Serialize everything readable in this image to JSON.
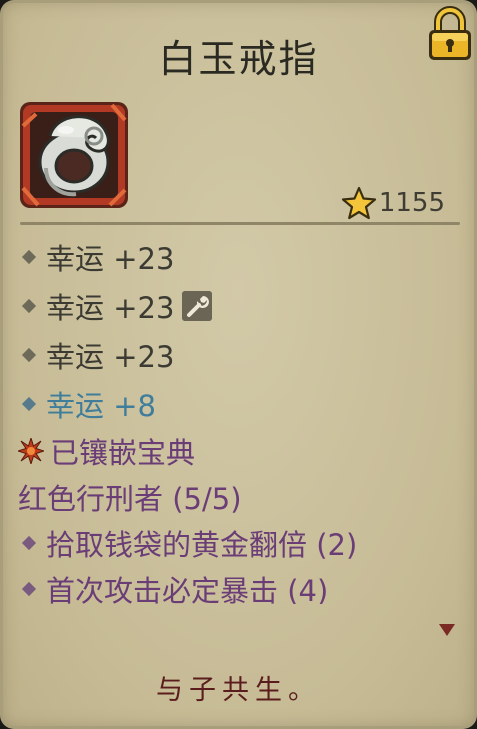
{
  "item": {
    "title": "白玉戒指",
    "icon": "jade-ring-icon",
    "score": "1155",
    "score_icon": "star-icon",
    "locked": true
  },
  "stats": [
    {
      "label": "幸运 +23",
      "color": "#3c3b33"
    },
    {
      "label": "幸运 +23",
      "color": "#3c3b33",
      "icon": "wrench-icon"
    },
    {
      "label": "幸运 +23",
      "color": "#3c3b33"
    },
    {
      "label": "幸运 +8",
      "color": "#3f7d9b"
    }
  ],
  "gem": {
    "label": "已镶嵌宝典",
    "icon": "red-burst-icon"
  },
  "set": {
    "name": "红色行刑者 (5/5)",
    "bonuses": [
      "拾取钱袋的黄金翻倍 (2)",
      "首次攻击必定暴击 (4)"
    ]
  },
  "flavor_text": "与子共生。",
  "colors": {
    "panel": "#c9bf9c",
    "normal_text": "#3c3b33",
    "magic_text": "#3f7d9b",
    "set_text": "#6b3d77",
    "flavor_text": "#5a1c1c",
    "lock": "#e8b520"
  }
}
